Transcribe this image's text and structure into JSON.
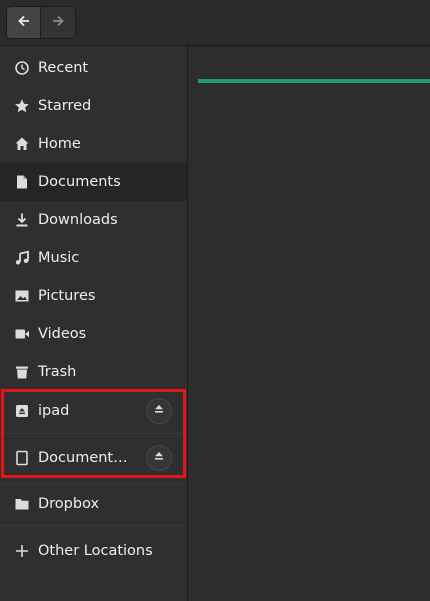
{
  "sidebar": {
    "items": [
      {
        "label": "Recent",
        "icon": "clock-icon"
      },
      {
        "label": "Starred",
        "icon": "star-icon"
      },
      {
        "label": "Home",
        "icon": "home-icon"
      },
      {
        "label": "Documents",
        "icon": "document-icon",
        "selected": true
      },
      {
        "label": "Downloads",
        "icon": "download-icon"
      },
      {
        "label": "Music",
        "icon": "music-icon"
      },
      {
        "label": "Pictures",
        "icon": "picture-icon"
      },
      {
        "label": "Videos",
        "icon": "video-icon"
      },
      {
        "label": "Trash",
        "icon": "trash-icon"
      }
    ],
    "devices": [
      {
        "label": "ipad",
        "icon": "drive-icon",
        "eject_icon": "eject-icon"
      },
      {
        "label": "Documents on ipad",
        "icon": "tablet-icon",
        "eject_icon": "eject-icon"
      }
    ],
    "network": [
      {
        "label": "Dropbox",
        "icon": "folder-icon"
      }
    ],
    "other_locations": {
      "label": "Other Locations",
      "icon": "plus-icon"
    }
  },
  "colors": {
    "accent": "#1f9a78",
    "highlight_border": "#e3141a"
  }
}
